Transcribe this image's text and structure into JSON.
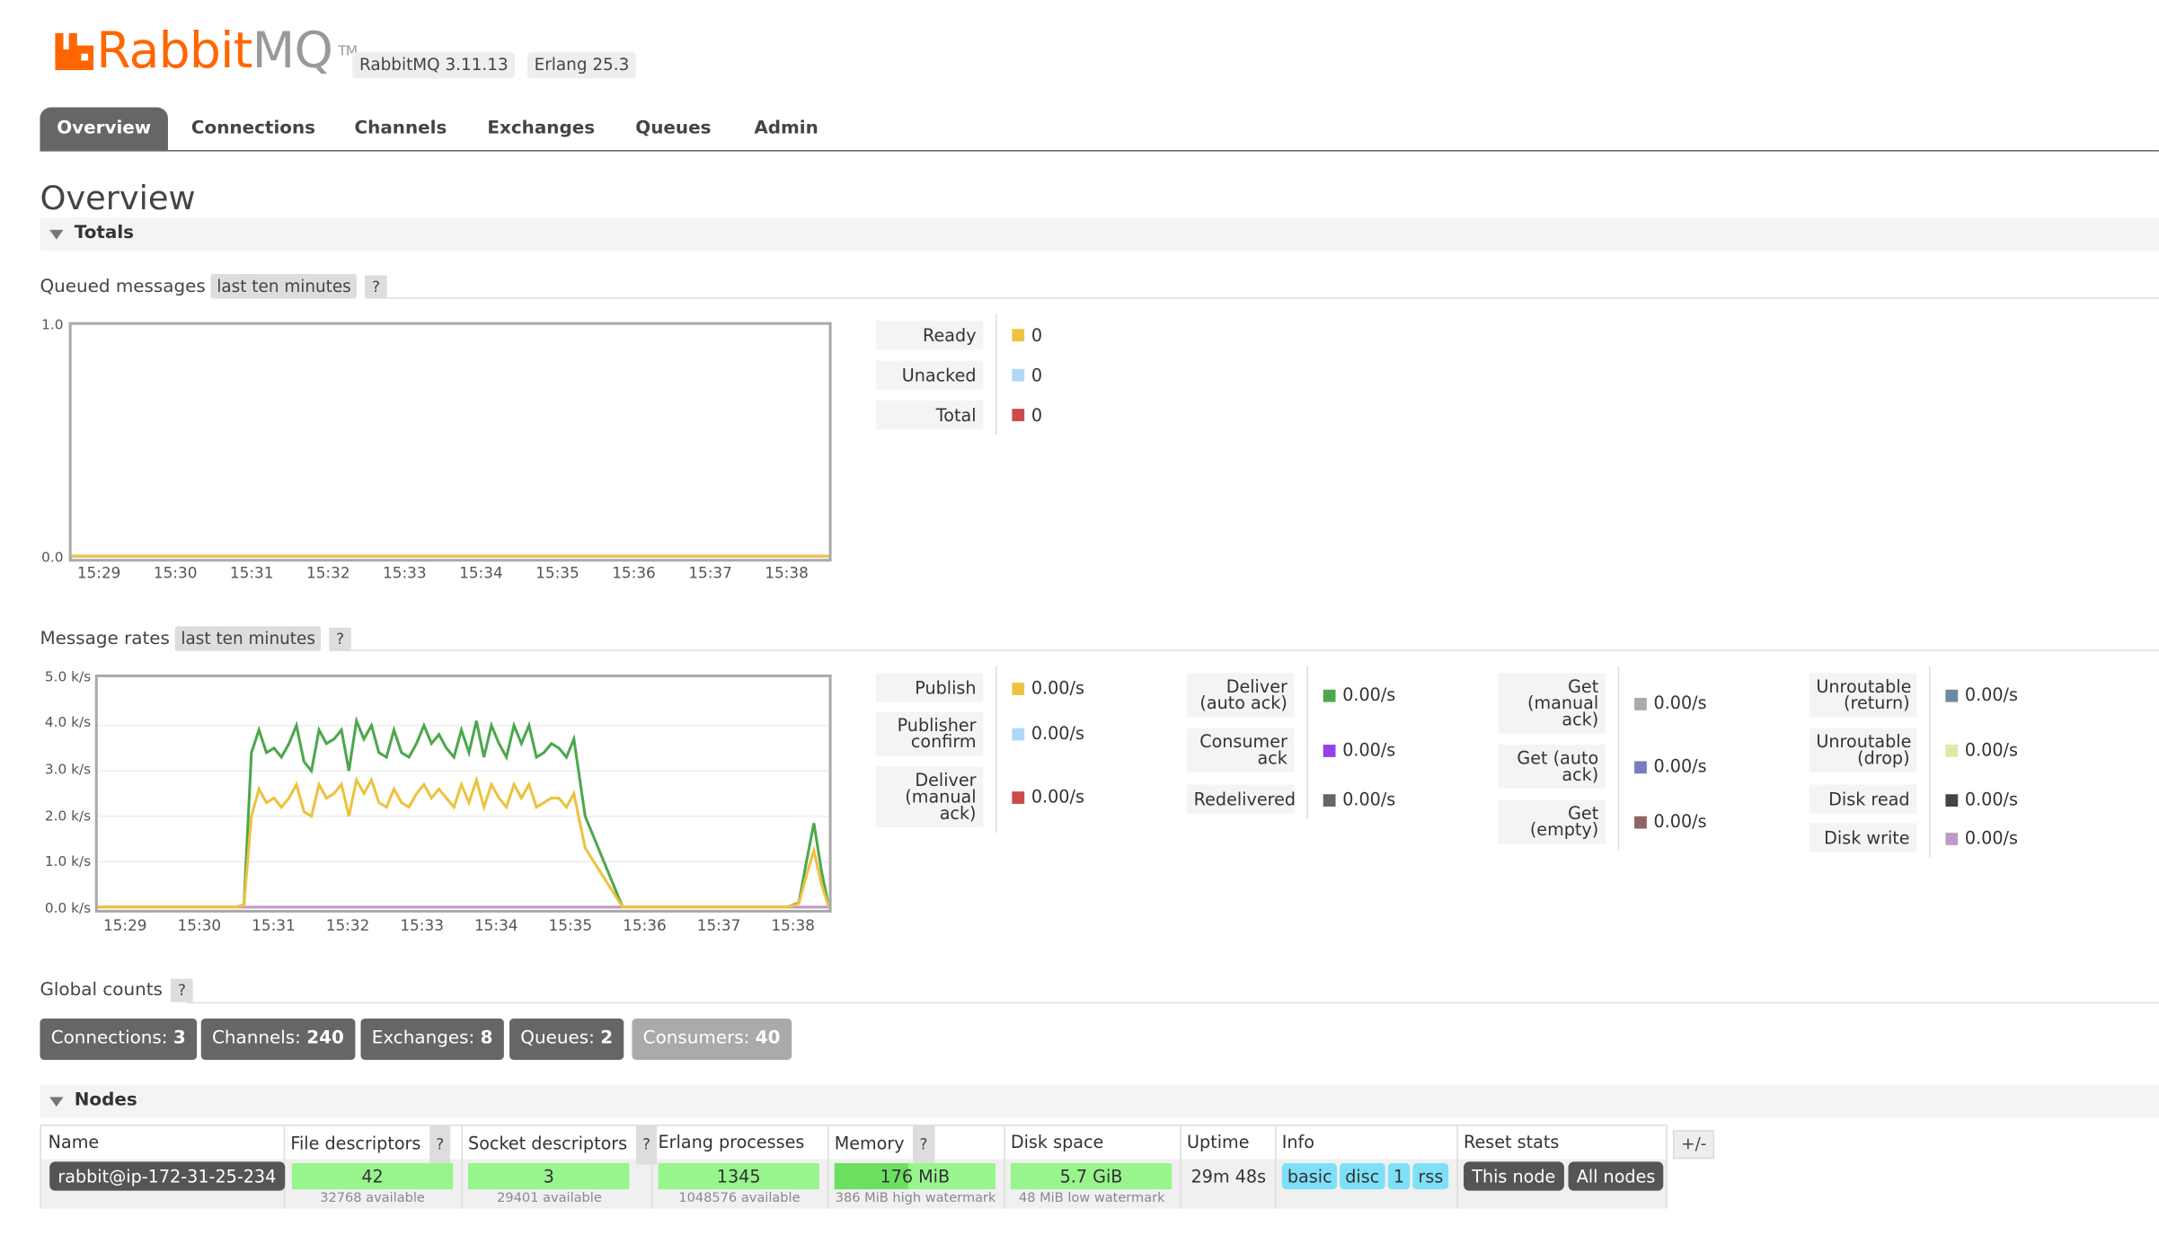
{
  "header": {
    "logo_main": "Rabbit",
    "logo_accent": "MQ",
    "logo_tm": "TM",
    "version_rabbitmq": "RabbitMQ 3.11.13",
    "version_erlang": "Erlang 25.3"
  },
  "tabs": [
    "Overview",
    "Connections",
    "Channels",
    "Exchanges",
    "Queues",
    "Admin"
  ],
  "active_tab": "Overview",
  "page_title": "Overview",
  "totals_section": "Totals",
  "queued": {
    "heading": "Queued messages",
    "range_label": "last ten minutes",
    "help": "?",
    "legend": [
      {
        "label": "Ready",
        "value": "0",
        "color": "#edc240"
      },
      {
        "label": "Unacked",
        "value": "0",
        "color": "#afd8f8"
      },
      {
        "label": "Total",
        "value": "0",
        "color": "#cb4b4b"
      }
    ]
  },
  "rates": {
    "heading": "Message rates",
    "range_label": "last ten minutes",
    "help": "?",
    "legend_cols": [
      [
        {
          "label": "Publish",
          "value": "0.00/s",
          "color": "#edc240"
        },
        {
          "label": "Publisher confirm",
          "value": "0.00/s",
          "color": "#afd8f8"
        },
        {
          "label": "Deliver (manual ack)",
          "value": "0.00/s",
          "color": "#cb4b4b"
        }
      ],
      [
        {
          "label": "Deliver (auto ack)",
          "value": "0.00/s",
          "color": "#4da74d"
        },
        {
          "label": "Consumer ack",
          "value": "0.00/s",
          "color": "#9440ed"
        },
        {
          "label": "Redelivered",
          "value": "0.00/s",
          "color": "#666666"
        }
      ],
      [
        {
          "label": "Get (manual ack)",
          "value": "0.00/s",
          "color": "#aaaaaa"
        },
        {
          "label": "Get (auto ack)",
          "value": "0.00/s",
          "color": "#7c79c3"
        },
        {
          "label": "Get (empty)",
          "value": "0.00/s",
          "color": "#8d6363"
        }
      ],
      [
        {
          "label": "Unroutable (return)",
          "value": "0.00/s",
          "color": "#6f8aa0"
        },
        {
          "label": "Unroutable (drop)",
          "value": "0.00/s",
          "color": "#e6e6a8"
        },
        {
          "label": "Disk read",
          "value": "0.00/s",
          "color": "#444444"
        },
        {
          "label": "Disk write",
          "value": "0.00/s",
          "color": "#c199c9"
        }
      ]
    ]
  },
  "chart_data": [
    {
      "type": "line",
      "title": "Queued messages",
      "x": [
        "15:29",
        "15:30",
        "15:31",
        "15:32",
        "15:33",
        "15:34",
        "15:35",
        "15:36",
        "15:37",
        "15:38"
      ],
      "ylim": [
        0,
        1
      ],
      "yticks": [
        "0.0",
        "1.0"
      ],
      "series": [
        {
          "name": "Ready",
          "color": "#edc240",
          "values": [
            0,
            0,
            0,
            0,
            0,
            0,
            0,
            0,
            0,
            0
          ]
        },
        {
          "name": "Unacked",
          "color": "#afd8f8",
          "values": [
            0,
            0,
            0,
            0,
            0,
            0,
            0,
            0,
            0,
            0
          ]
        },
        {
          "name": "Total",
          "color": "#cb4b4b",
          "values": [
            0,
            0,
            0,
            0,
            0,
            0,
            0,
            0,
            0,
            0
          ]
        }
      ]
    },
    {
      "type": "line",
      "title": "Message rates",
      "x_ticks": [
        "15:29",
        "15:30",
        "15:31",
        "15:32",
        "15:33",
        "15:34",
        "15:35",
        "15:36",
        "15:37",
        "15:38"
      ],
      "ylim": [
        0,
        5000
      ],
      "yticks": [
        "0.0 k/s",
        "1.0 k/s",
        "2.0 k/s",
        "3.0 k/s",
        "4.0 k/s",
        "5.0 k/s"
      ],
      "x_minutes": [
        0,
        0.5,
        1,
        1.25,
        1.5,
        1.72,
        1.85,
        1.95,
        2.05,
        2.15,
        2.25,
        2.35,
        2.45,
        2.55,
        2.65,
        2.75,
        2.85,
        2.95,
        3.05,
        3.15,
        3.25,
        3.35,
        3.45,
        3.55,
        3.65,
        3.75,
        3.85,
        3.95,
        4.05,
        4.15,
        4.25,
        4.35,
        4.45,
        4.55,
        4.65,
        4.75,
        4.85,
        4.95,
        5.05,
        5.15,
        5.25,
        5.35,
        5.45,
        5.55,
        5.65,
        5.75,
        5.85,
        5.95,
        6.05,
        6.15,
        6.25,
        6.35,
        6.5,
        7,
        7.5,
        8,
        8.5,
        9,
        9.2,
        9.35,
        9.45,
        9.55,
        9.65,
        9.75
      ],
      "series": [
        {
          "name": "Deliver (auto ack)",
          "color": "#4da74d",
          "values": [
            0,
            0,
            0,
            0,
            0,
            0,
            0,
            50,
            3400,
            3900,
            3400,
            3500,
            3300,
            3600,
            4000,
            3200,
            3000,
            3900,
            3600,
            3700,
            3900,
            3000,
            4100,
            3700,
            4000,
            3400,
            3300,
            3900,
            3400,
            3300,
            3600,
            4000,
            3600,
            3800,
            3500,
            3300,
            3900,
            3400,
            4100,
            3300,
            4000,
            3600,
            3300,
            4000,
            3600,
            4000,
            3300,
            3400,
            3600,
            3500,
            3300,
            3700,
            2000,
            0,
            0,
            0,
            0,
            0,
            0,
            100,
            1000,
            1850,
            800,
            0
          ]
        },
        {
          "name": "Publish",
          "color": "#edc240",
          "values": [
            0,
            0,
            0,
            0,
            0,
            0,
            0,
            40,
            2000,
            2600,
            2300,
            2400,
            2200,
            2400,
            2700,
            2100,
            2000,
            2700,
            2400,
            2500,
            2700,
            2000,
            2800,
            2500,
            2800,
            2300,
            2200,
            2600,
            2300,
            2200,
            2500,
            2700,
            2400,
            2600,
            2400,
            2200,
            2700,
            2300,
            2800,
            2200,
            2700,
            2400,
            2200,
            2700,
            2400,
            2700,
            2200,
            2300,
            2400,
            2400,
            2200,
            2500,
            1300,
            0,
            0,
            0,
            0,
            0,
            0,
            80,
            700,
            1250,
            500,
            0
          ]
        }
      ]
    }
  ],
  "global_counts": {
    "heading": "Global counts",
    "help": "?",
    "items": [
      {
        "label": "Connections:",
        "value": "3"
      },
      {
        "label": "Channels:",
        "value": "240"
      },
      {
        "label": "Exchanges:",
        "value": "8"
      },
      {
        "label": "Queues:",
        "value": "2"
      },
      {
        "label": "Consumers:",
        "value": "40"
      }
    ]
  },
  "nodes": {
    "section": "Nodes",
    "headers": {
      "name": "Name",
      "fd": "File descriptors",
      "sd": "Socket descriptors",
      "ep": "Erlang processes",
      "mem": "Memory",
      "disk": "Disk space",
      "uptime": "Uptime",
      "info": "Info",
      "reset": "Reset stats"
    },
    "help": "?",
    "plus_minus": "+/-",
    "row": {
      "name": "rabbit@ip-172-31-25-234",
      "fd": "42",
      "fd_sub": "32768 available",
      "fd_fraction": 0.0013,
      "sd": "3",
      "sd_sub": "29401 available",
      "sd_fraction": 0.0001,
      "ep": "1345",
      "ep_sub": "1048576 available",
      "ep_fraction": 0.0013,
      "mem": "176 MiB",
      "mem_sub": "386 MiB high watermark",
      "mem_fraction": 0.46,
      "disk": "5.7 GiB",
      "disk_sub": "48 MiB low watermark",
      "uptime": "29m 48s",
      "info_tags": [
        "basic",
        "disc",
        "1",
        "rss"
      ],
      "reset_this": "This node",
      "reset_all": "All nodes"
    }
  }
}
